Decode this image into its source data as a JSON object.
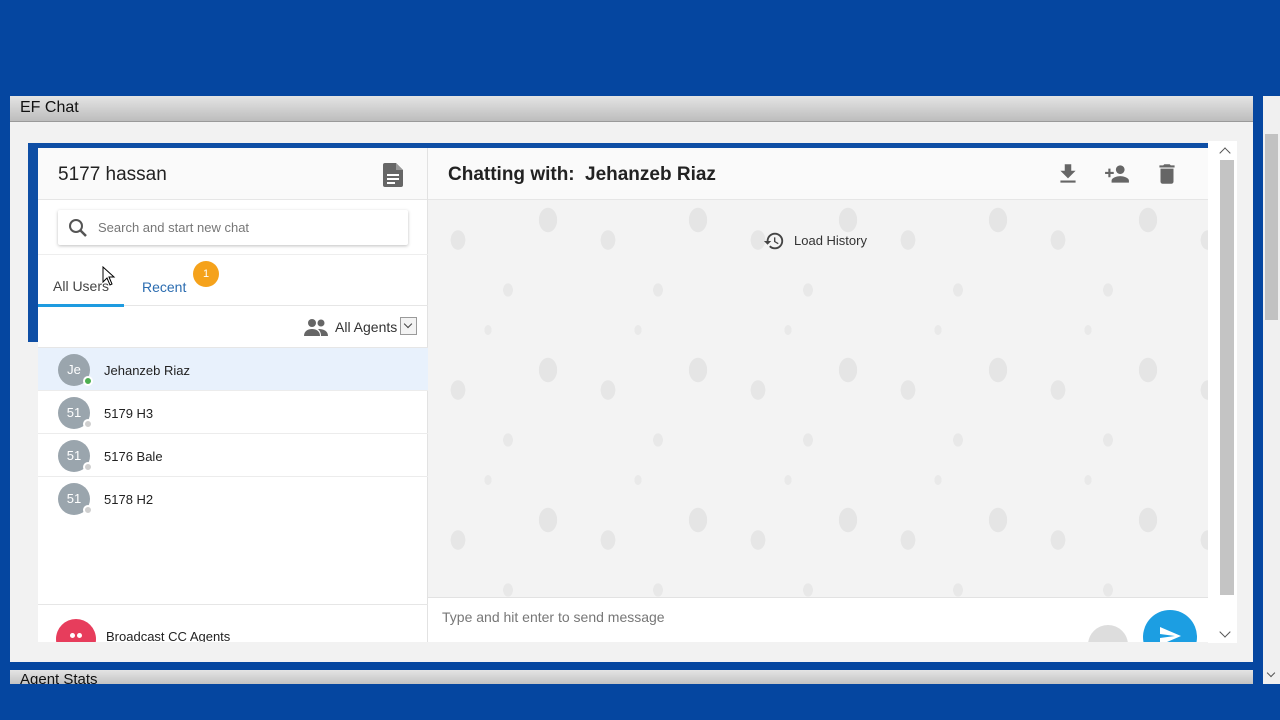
{
  "panel": {
    "title": "EF Chat"
  },
  "left": {
    "user_title": "5177 hassan",
    "search": {
      "placeholder": "Search and start new chat",
      "value": ""
    },
    "tabs": [
      {
        "label": "All Users"
      },
      {
        "label": "Recent"
      }
    ],
    "recent_badge": "1",
    "filter_label": "All Agents",
    "users": [
      {
        "initials": "Je",
        "name": "Jehanzeb Riaz",
        "status": "online"
      },
      {
        "initials": "51",
        "name": "5179 H3",
        "status": "offline"
      },
      {
        "initials": "51",
        "name": "5176 Bale",
        "status": "offline"
      },
      {
        "initials": "51",
        "name": "5178 H2",
        "status": "offline"
      }
    ],
    "broadcast_label": "Broadcast CC Agents"
  },
  "chat": {
    "prefix": "Chatting with:",
    "name": "Jehanzeb Riaz",
    "load_history": "Load History",
    "composer_placeholder": "Type and hit enter to send message"
  },
  "footer": {
    "stats_title": "Agent Stats"
  },
  "colors": {
    "brand_blue": "#0546a0",
    "accent": "#1c9ee2",
    "badge": "#f5a21b",
    "online": "#4caf50",
    "offline": "#cfcfcf",
    "broadcast": "#e73d5c"
  },
  "icons": [
    "document-icon",
    "search-icon",
    "people-icon",
    "history-icon",
    "download-icon",
    "add-person-icon",
    "trash-icon",
    "send-icon",
    "mouse-cursor-icon"
  ]
}
